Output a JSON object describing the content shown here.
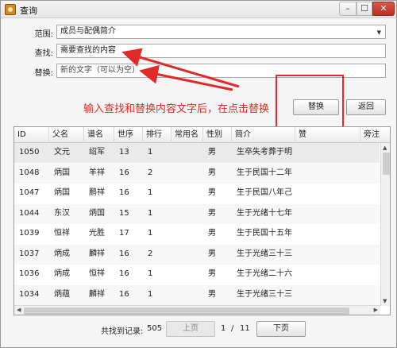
{
  "window": {
    "title": "查询",
    "close_glyph": "✕",
    "minimize_glyph": "–",
    "maximize_glyph": "☐"
  },
  "form": {
    "range_label": "范围:",
    "range_value": "成员与配偶简介",
    "find_label": "查找:",
    "find_value": "需要查找的内容",
    "replace_label": "替换:",
    "replace_value": "新的文字（可以为空）"
  },
  "buttons": {
    "replace": "替换",
    "back": "返回",
    "prev_page": "上页",
    "next_page": "下页"
  },
  "annotation": {
    "text": "输入查找和替换内容文字后，在点击替换",
    "color": "#e12b2b"
  },
  "table": {
    "columns": [
      "ID",
      "父名",
      "谱名",
      "世序",
      "排行",
      "常用名",
      "性别",
      "简介",
      "赞",
      "旁注"
    ],
    "rows": [
      [
        "1050",
        "文元",
        "绍军",
        "13",
        "1",
        "",
        "男",
        "生卒失考葬于明",
        "",
        ""
      ],
      [
        "1048",
        "炳国",
        "羊祥",
        "16",
        "2",
        "",
        "男",
        "生于民国十二年",
        "",
        ""
      ],
      [
        "1047",
        "炳国",
        "鹏祥",
        "16",
        "1",
        "",
        "男",
        "生于民国八年己",
        "",
        ""
      ],
      [
        "1044",
        "东汉",
        "炳国",
        "15",
        "1",
        "",
        "男",
        "生于光绪十七年",
        "",
        ""
      ],
      [
        "1039",
        "恒祥",
        "光胜",
        "17",
        "1",
        "",
        "男",
        "生于民国十五年",
        "",
        ""
      ],
      [
        "1037",
        "炳成",
        "麟祥",
        "16",
        "2",
        "",
        "男",
        "生于光绪三十三",
        "",
        ""
      ],
      [
        "1036",
        "炳成",
        "恒祥",
        "16",
        "1",
        "",
        "男",
        "生于光绪二十六",
        "",
        ""
      ],
      [
        "1034",
        "炳蕴",
        "麟祥",
        "16",
        "1",
        "",
        "男",
        "生于光绪三十三",
        "",
        ""
      ]
    ]
  },
  "pager": {
    "records_label": "共找到记录:",
    "records_count": "505",
    "current_page": "1",
    "separator": "/",
    "total_pages": "11"
  }
}
